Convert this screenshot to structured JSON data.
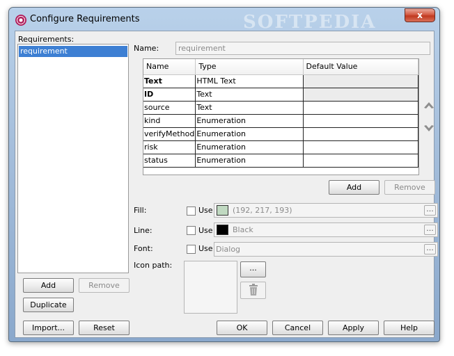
{
  "window": {
    "title": "Configure Requirements",
    "close_label": "x",
    "watermark": "SOFTPEDIA"
  },
  "left": {
    "requirements_label": "Requirements:",
    "items": [
      "requirement"
    ],
    "add_label": "Add",
    "remove_label": "Remove",
    "duplicate_label": "Duplicate",
    "import_label": "Import...",
    "reset_label": "Reset"
  },
  "right": {
    "name_label": "Name:",
    "name_value": "requirement",
    "table": {
      "headers": [
        "Name",
        "Type",
        "Default Value"
      ],
      "rows": [
        {
          "name": "Text",
          "type": "HTML Text",
          "default": ""
        },
        {
          "name": "ID",
          "type": "Text",
          "default": ""
        },
        {
          "name": "source",
          "type": "Text",
          "default": ""
        },
        {
          "name": "kind",
          "type": "Enumeration",
          "default": ""
        },
        {
          "name": "verifyMethod",
          "type": "Enumeration",
          "default": ""
        },
        {
          "name": "risk",
          "type": "Enumeration",
          "default": ""
        },
        {
          "name": "status",
          "type": "Enumeration",
          "default": ""
        }
      ]
    },
    "add_label": "Add",
    "remove_label": "Remove",
    "fill_label": "Fill:",
    "fill_use": "Use",
    "fill_value": "(192, 217, 193)",
    "fill_color": "#c0d9c1",
    "line_label": "Line:",
    "line_use": "Use",
    "line_value": "Black",
    "line_color": "#000000",
    "font_label": "Font:",
    "font_use": "Use",
    "font_value": "Dialog",
    "icon_path_label": "Icon path:",
    "browse_label": "...",
    "dots_label": "..."
  },
  "footer": {
    "ok_label": "OK",
    "cancel_label": "Cancel",
    "apply_label": "Apply",
    "help_label": "Help"
  },
  "colors": {
    "selection": "#3d7fd3",
    "close_button": "#c0391f"
  }
}
